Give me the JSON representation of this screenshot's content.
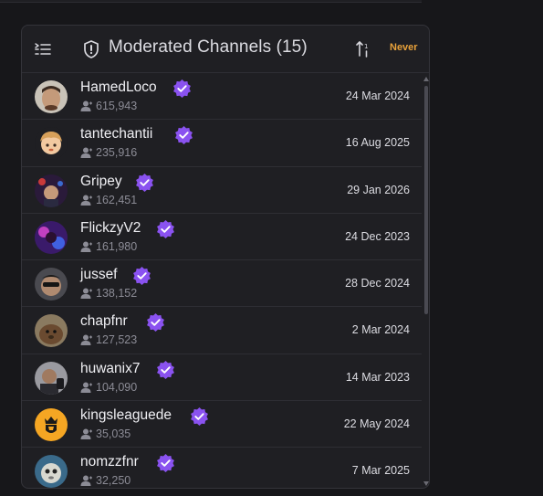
{
  "header": {
    "title": "Moderated Channels (15)",
    "never_label": "Never"
  },
  "colors": {
    "accent_purple": "#8a52f0",
    "never_orange": "#e8a13a",
    "panel_bg": "#1f1f23",
    "page_bg": "#17171a"
  },
  "channels": [
    {
      "name": "HamedLoco",
      "followers": "615,943",
      "date": "24 Mar 2024",
      "verified": true
    },
    {
      "name": "tantechantii",
      "followers": "235,916",
      "date": "16 Aug 2025",
      "verified": true
    },
    {
      "name": "Gripey",
      "followers": "162,451",
      "date": "29 Jan 2026",
      "verified": true
    },
    {
      "name": "FlickzyV2",
      "followers": "161,980",
      "date": "24 Dec 2023",
      "verified": true
    },
    {
      "name": "jussef",
      "followers": "138,152",
      "date": "28 Dec 2024",
      "verified": true
    },
    {
      "name": "chapfnr",
      "followers": "127,523",
      "date": "2 Mar 2024",
      "verified": true
    },
    {
      "name": "huwanix7",
      "followers": "104,090",
      "date": "14 Mar 2023",
      "verified": true
    },
    {
      "name": "kingsleaguede",
      "followers": "35,035",
      "date": "22 May 2024",
      "verified": true
    },
    {
      "name": "nomzzfnr",
      "followers": "32,250",
      "date": "7 Mar 2025",
      "verified": true
    }
  ]
}
